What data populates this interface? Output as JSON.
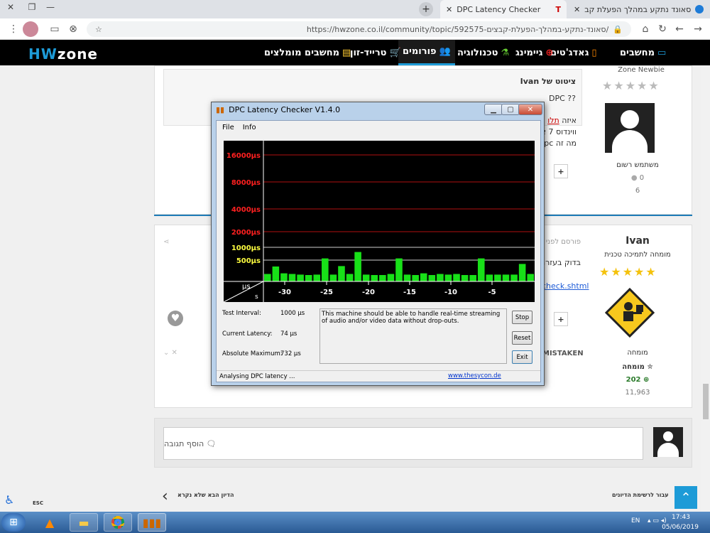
{
  "browser": {
    "tabs": [
      {
        "title": "DPC Latency Checker",
        "active": true
      },
      {
        "title": "סאונד נתקע במהלך הפעלת קב",
        "active": false
      }
    ],
    "new_tab": "+",
    "url": "https://hwzone.co.il/community/topic/592575-סאונד-נתקע-במהלך-הפעלת-קבצים/"
  },
  "site": {
    "logo_prefix": "HW",
    "logo_suffix": "zone",
    "nav": [
      {
        "label": "מחשבים",
        "icon": "laptop-icon"
      },
      {
        "label": "גאדג'טים",
        "icon": "phone-icon"
      },
      {
        "label": "גיימינג",
        "icon": "gamepad-icon"
      },
      {
        "label": "טכנולוגיה",
        "icon": "flask-icon"
      },
      {
        "label": "פורומים",
        "icon": "users-icon"
      },
      {
        "label": "טרייד-זון",
        "icon": "cart-icon"
      },
      {
        "label": "מחשבים מומלצים",
        "icon": "list-icon"
      }
    ]
  },
  "post1": {
    "rank": "Zone Newbie",
    "role": "משתמש רשום",
    "reputation": "0",
    "posts": "6",
    "quote_header": "ציטוט של Ivan",
    "quote_text": "DPC ??",
    "partial_line1": "איזה",
    "partial_link": "תלו",
    "partial_line2": "ווינדוס 7 או",
    "partial_line3": "מה זה dpc?"
  },
  "post2": {
    "author": "Ivan",
    "role": "מומחה לתמיכה טכנית",
    "badge": "מומחה",
    "badge2": "מומחה",
    "reputation": "202",
    "posts": "11,963",
    "posted_prefix": "פורסם לפני 2",
    "partial_line1": "בדוק בעזרת",
    "partial_link": "check.shtml",
    "mistaken": "MISTAKEN"
  },
  "reply": {
    "placeholder": "הוסף תגובה"
  },
  "footer_nav": {
    "next": "הדיון הבא שלא נקרא",
    "back": "עבור לרשימת הדיונים",
    "esc": "ESC"
  },
  "dpc": {
    "title": "DPC Latency Checker V1.4.0",
    "menu": [
      "File",
      "Info"
    ],
    "y_labels": [
      {
        "text": "16000µs",
        "color": "#ff2020"
      },
      {
        "text": "8000µs",
        "color": "#ff2020"
      },
      {
        "text": "4000µs",
        "color": "#ff2020"
      },
      {
        "text": "2000µs",
        "color": "#ff2020"
      },
      {
        "text": "1000µs",
        "color": "#ffff40"
      },
      {
        "text": "500µs",
        "color": "#ffff40"
      }
    ],
    "x_labels": [
      "-30",
      "-25",
      "-20",
      "-15",
      "-10",
      "-5"
    ],
    "unit_y": "µs",
    "unit_x": "s",
    "bars": [
      0.35,
      0.7,
      0.38,
      0.35,
      0.32,
      0.3,
      0.32,
      1.08,
      0.32,
      0.72,
      0.35,
      1.38,
      0.32,
      0.3,
      0.3,
      0.35,
      1.08,
      0.32,
      0.3,
      0.38,
      0.3,
      0.35,
      0.32,
      0.35,
      0.3,
      0.3,
      1.08,
      0.32,
      0.32,
      0.32,
      0.32,
      0.82,
      0.35
    ],
    "test_interval_label": "Test Interval:",
    "test_interval": "1000 µs",
    "current_latency_label": "Current Latency:",
    "current_latency": "74 µs",
    "absolute_max_label": "Absolute Maximum:",
    "absolute_max": "732 µs",
    "message": "This machine should be able to handle real-time streaming of audio and/or video data without drop-outs.",
    "buttons": {
      "stop": "Stop",
      "reset": "Reset",
      "exit": "Exit"
    },
    "status": "Analysing DPC latency ...",
    "link": "www.thesycon.de"
  },
  "taskbar": {
    "lang": "EN",
    "time": "17:43",
    "date": "05/06/2019"
  }
}
